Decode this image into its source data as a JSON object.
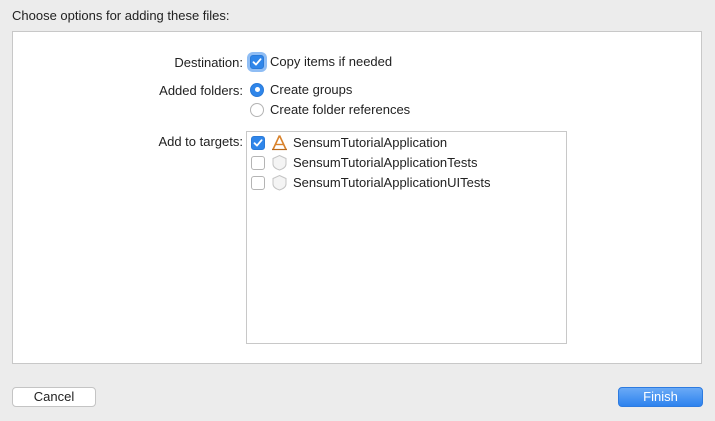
{
  "dialog": {
    "title": "Choose options for adding these files:"
  },
  "destination": {
    "label": "Destination:",
    "copy_items_label": "Copy items if needed",
    "copy_items_checked": true
  },
  "added_folders": {
    "label": "Added folders:",
    "options": [
      {
        "label": "Create groups",
        "selected": true
      },
      {
        "label": "Create folder references",
        "selected": false
      }
    ]
  },
  "targets": {
    "label": "Add to targets:",
    "items": [
      {
        "name": "SensumTutorialApplication",
        "checked": true,
        "icon": "app-target-icon"
      },
      {
        "name": "SensumTutorialApplicationTests",
        "checked": false,
        "icon": "test-target-icon"
      },
      {
        "name": "SensumTutorialApplicationUITests",
        "checked": false,
        "icon": "test-target-icon"
      }
    ]
  },
  "buttons": {
    "cancel_label": "Cancel",
    "finish_label": "Finish"
  },
  "colors": {
    "accent": "#2f86ea",
    "window_bg": "#ececec"
  }
}
